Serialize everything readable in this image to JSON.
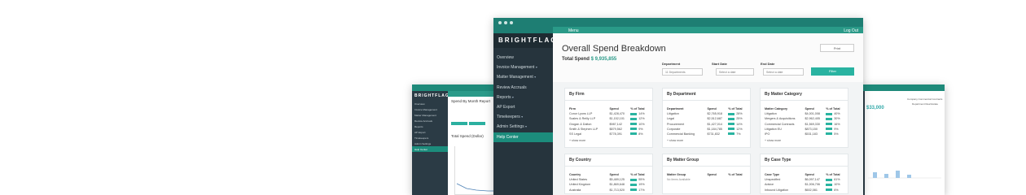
{
  "main": {
    "brand": "BRIGHTFLAG",
    "menu_label": "Menu",
    "logout_label": "Log Out",
    "nav": [
      {
        "label": "Overview",
        "caret": ""
      },
      {
        "label": "Invoice Management",
        "caret": "▾"
      },
      {
        "label": "Matter Management",
        "caret": "▾"
      },
      {
        "label": "Review Accruals",
        "caret": ""
      },
      {
        "label": "Reports",
        "caret": "▾"
      },
      {
        "label": "AP Export",
        "caret": ""
      },
      {
        "label": "Timekeepers",
        "caret": "▾"
      },
      {
        "label": "Admin Settings",
        "caret": "▾"
      },
      {
        "label": "Help Center",
        "caret": ""
      }
    ],
    "page_title": "Overall Spend Breakdown",
    "total_label": "Total Spend",
    "total_value": "$ 9,935,855",
    "print_label": "Print",
    "filters": {
      "department_label": "Department",
      "department_value": "11 Departments",
      "start_label": "Start Date",
      "start_placeholder": "Select a date",
      "end_label": "End Date",
      "end_placeholder": "Select a date",
      "filter_button": "Filter"
    },
    "cards": {
      "by_firm": {
        "title": "By Firm",
        "headers": [
          "Firm",
          "Spend",
          "% of Total"
        ],
        "rows": [
          [
            "Conor Lyons LLP",
            "$1,428,470",
            "14%"
          ],
          [
            "Scales & Reilly LLP",
            "$1,152,101",
            "12%"
          ],
          [
            "Grogan & Dalton",
            "$987,142",
            "10%"
          ],
          [
            "Smith & Stephen LLP",
            "$879,562",
            "9%"
          ],
          [
            "SS Legal",
            "$778,391",
            "8%"
          ]
        ],
        "more": "+ show more"
      },
      "by_department": {
        "title": "By Department",
        "headers": [
          "Department",
          "Spend",
          "% of Total"
        ],
        "rows": [
          [
            "Litigation",
            "$2,765,918",
            "28%"
          ],
          [
            "Legal",
            "$2,512,687",
            "25%"
          ],
          [
            "Procurement",
            "$1,427,014",
            "14%"
          ],
          [
            "Corporate",
            "$1,184,785",
            "12%"
          ],
          [
            "Commercial Banking",
            "$731,832",
            "7%"
          ]
        ],
        "more": "+ show more"
      },
      "by_matter_category": {
        "title": "By Matter Category",
        "headers": [
          "Matter Category",
          "Spend",
          "% of Total"
        ],
        "rows": [
          [
            "Litigation",
            "$4,001,008",
            "40%"
          ],
          [
            "Mergers & Acquisitions",
            "$2,962,405",
            "30%"
          ],
          [
            "Commercial Contracts",
            "$1,569,330",
            "16%"
          ],
          [
            "Litigation EU",
            "$873,150",
            "9%"
          ],
          [
            "IPO",
            "$531,183",
            "5%"
          ]
        ],
        "more": "+ show more"
      },
      "by_country": {
        "title": "By Country",
        "headers": [
          "Country",
          "Spend",
          "% of Total"
        ],
        "rows": [
          [
            "United States",
            "$5,489,125",
            "55%"
          ],
          [
            "United Kingdom",
            "$1,869,648",
            "19%"
          ],
          [
            "Australia",
            "$1,713,520",
            "17%"
          ]
        ]
      },
      "by_matter_group": {
        "title": "By Matter Group",
        "headers": [
          "Matter Group",
          "Spend",
          "% of Total"
        ],
        "empty": "No items Available"
      },
      "by_case_type": {
        "title": "By Case Type",
        "headers": [
          "Case Type",
          "Spend",
          "% of Total"
        ],
        "rows": [
          [
            "Unspecified",
            "$6,097,147",
            "61%"
          ],
          [
            "Advice",
            "$1,006,706",
            "10%"
          ],
          [
            "Inbound Litigation",
            "$602,081",
            "6%"
          ]
        ]
      }
    }
  },
  "left_window": {
    "brand": "BRIGHTFLAG",
    "nav": [
      "Overview",
      "Invoice Management",
      "Matter Management",
      "Review Accruals",
      "Reports",
      "AP Export",
      "Timekeepers",
      "Admin Settings",
      "Help Center"
    ],
    "title": "Spend By Month Report",
    "chart_title": "Total Spend (Dollar)"
  },
  "right_window": {
    "big_value": "$33,000",
    "company": "Company Commercial Contracts",
    "department": "Department Real Estate"
  },
  "colors": {
    "accent": "#2ab4a1",
    "titlebar": "#1e7e73",
    "sidebar": "#26343d"
  }
}
